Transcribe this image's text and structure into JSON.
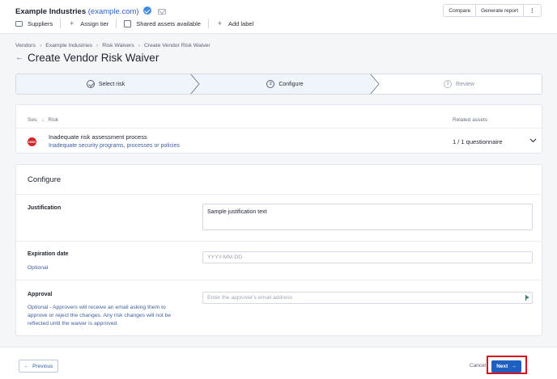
{
  "header": {
    "vendor_name": "Example Industries",
    "vendor_domain": "(example.com)",
    "actions": {
      "suppliers": "Suppliers",
      "assign_tier": "Assign tier",
      "shared_assets": "Shared assets available",
      "add_label": "Add label"
    },
    "buttons": {
      "compare": "Compare",
      "generate_report": "Generate report",
      "more": "⋮"
    }
  },
  "breadcrumb": [
    "Vendors",
    "Example Industries",
    "Risk Waivers",
    "Create Vendor Risk Waiver"
  ],
  "page_title": "Create Vendor Risk Waiver",
  "stepper": {
    "steps": [
      {
        "label": "Select risk",
        "number": "",
        "state": "completed"
      },
      {
        "label": "Configure",
        "number": "2",
        "state": "active"
      },
      {
        "label": "Review",
        "number": "3",
        "state": "upcoming"
      }
    ]
  },
  "risk_table": {
    "col_severity": "Sev.",
    "col_risk": "Risk",
    "col_assets": "Related assets",
    "row": {
      "severity_label": "HIGH",
      "name": "Inadequate risk assessment process",
      "category": "Inadequate security programs, processes or policies",
      "assets": "1 / 1 questionnaire"
    }
  },
  "configure": {
    "title": "Configure",
    "justification": {
      "label": "Justification",
      "value": "Sample justification text"
    },
    "expiration": {
      "label": "Expiration date",
      "help": "Optional",
      "placeholder": "YYYY-MM-DD"
    },
    "approval": {
      "label": "Approval",
      "help": "Optional - Approvers will receive an email asking them to approve or reject the changes. Any risk changes will not be reflected until the waiver is approved.",
      "placeholder": "Enter the approver's email address"
    }
  },
  "footer": {
    "previous": "Previous",
    "cancel": "Cancel",
    "next": "Next"
  },
  "colors": {
    "accent": "#1f5fbf",
    "severity_high": "#d3262b",
    "highlight": "#d6131c"
  }
}
